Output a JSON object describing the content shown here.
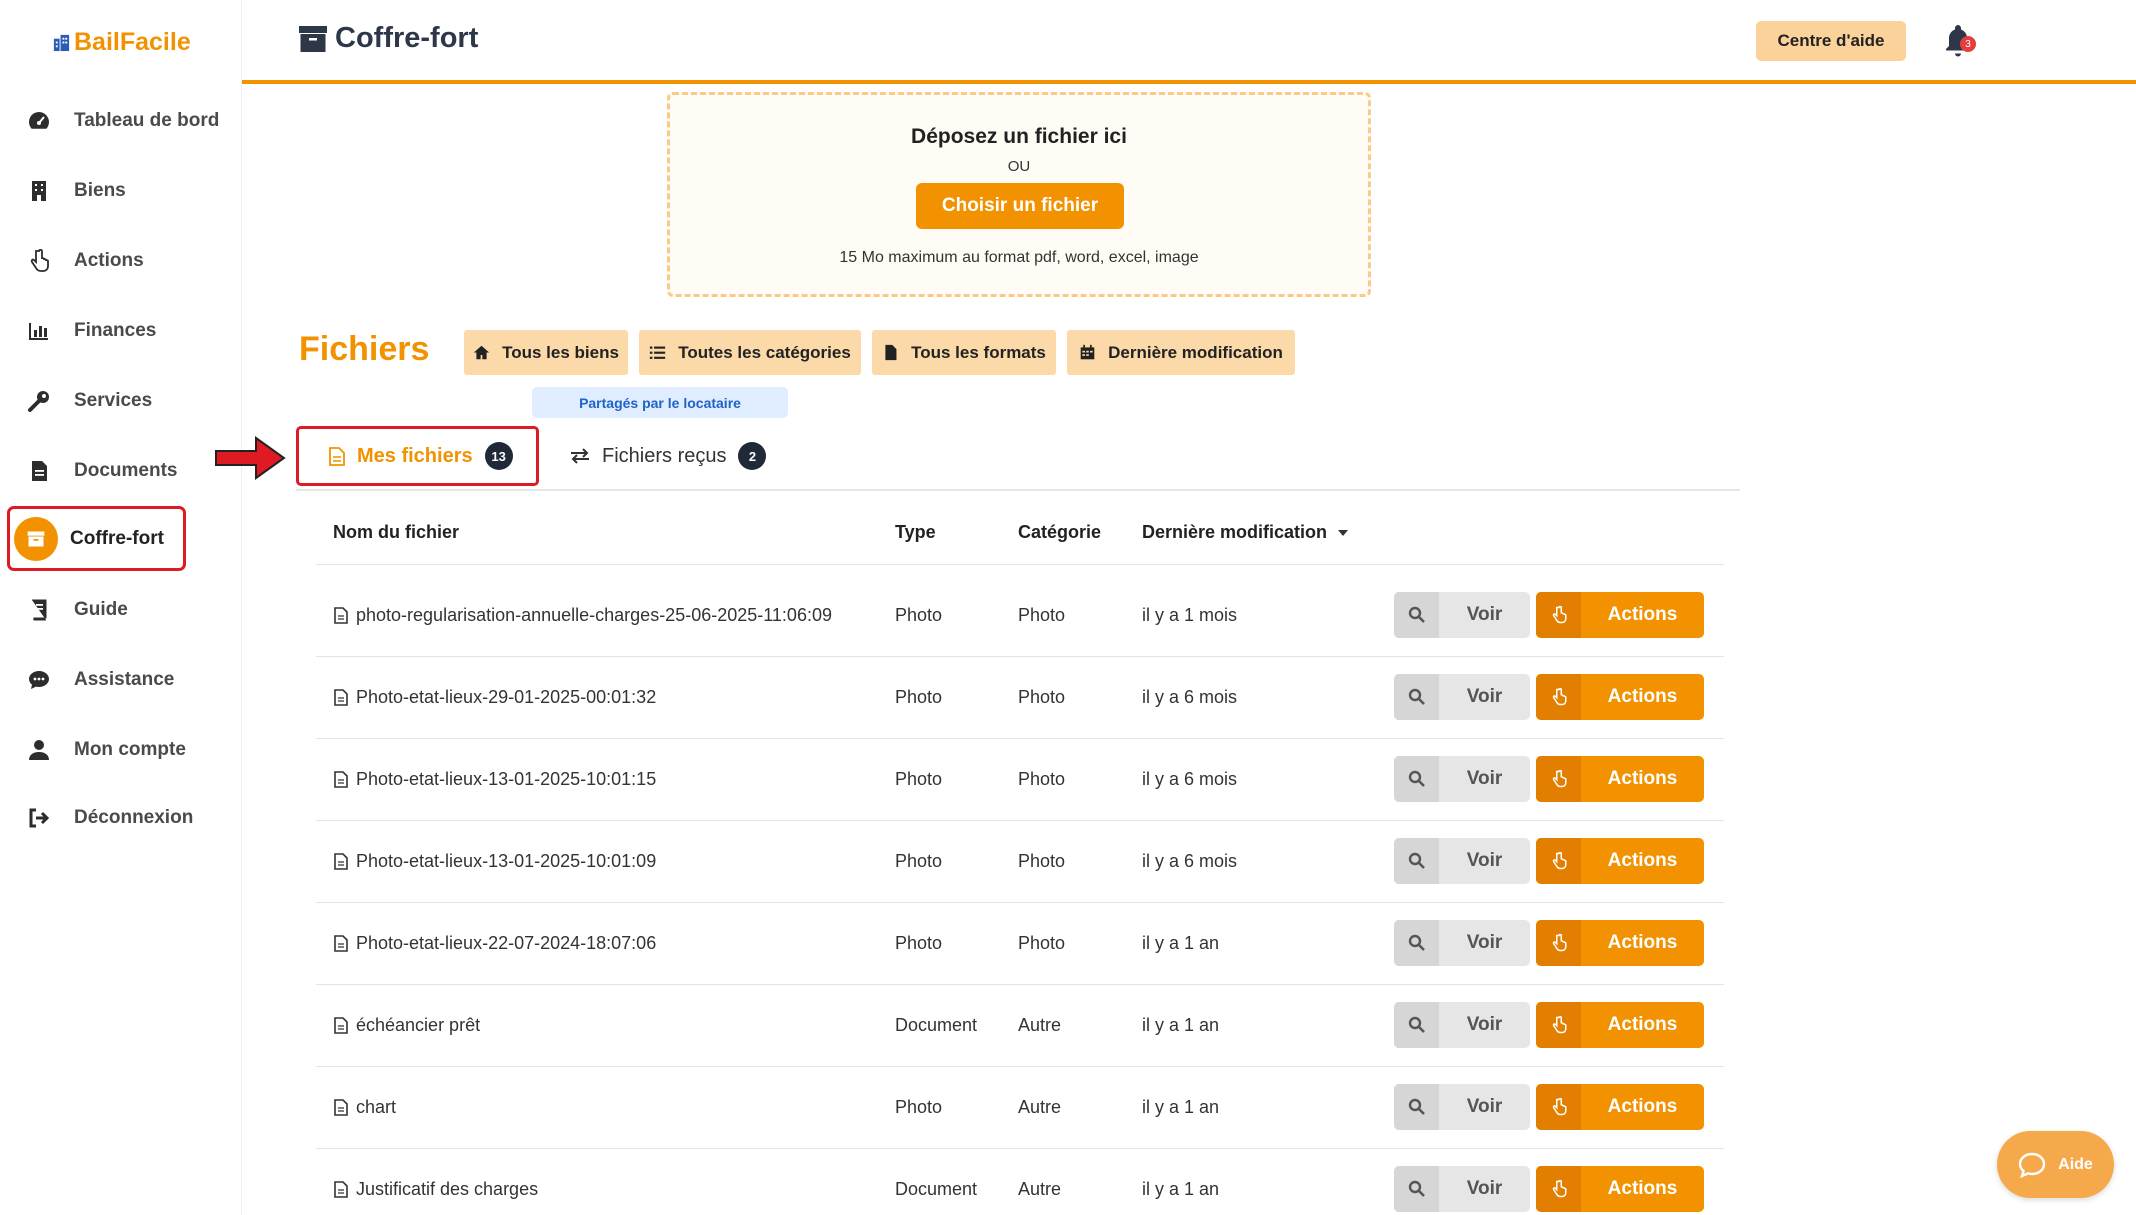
{
  "brand": {
    "name": "BailFacile",
    "color": "#f39200"
  },
  "sidebar": {
    "items": [
      {
        "label": "Tableau de bord",
        "icon": "dashboard-icon"
      },
      {
        "label": "Biens",
        "icon": "building-icon"
      },
      {
        "label": "Actions",
        "icon": "pointer-hand-icon"
      },
      {
        "label": "Finances",
        "icon": "bar-chart-icon"
      },
      {
        "label": "Services",
        "icon": "wrench-icon"
      },
      {
        "label": "Documents",
        "icon": "document-icon"
      },
      {
        "label": "Coffre-fort",
        "icon": "archive-icon",
        "active": true
      },
      {
        "label": "Guide",
        "icon": "book-icon"
      },
      {
        "label": "Assistance",
        "icon": "chat-icon"
      },
      {
        "label": "Mon compte",
        "icon": "user-icon"
      },
      {
        "label": "Déconnexion",
        "icon": "logout-icon"
      }
    ]
  },
  "header": {
    "title": "Coffre-fort",
    "help_label": "Centre d'aide",
    "notification_count": "3"
  },
  "upload": {
    "title": "Déposez un fichier ici",
    "or": "OU",
    "button": "Choisir un fichier",
    "hint": "15 Mo maximum au format pdf, word, excel, image"
  },
  "files": {
    "title": "Fichiers",
    "filters": [
      "Tous les biens",
      "Toutes les catégories",
      "Tous les formats",
      "Dernière modification"
    ],
    "shared_badge": "Partagés par le locataire",
    "tabs": [
      {
        "label": "Mes fichiers",
        "count": "13",
        "active": true
      },
      {
        "label": "Fichiers reçus",
        "count": "2"
      }
    ],
    "columns": [
      "Nom du fichier",
      "Type",
      "Catégorie",
      "Dernière modification"
    ],
    "view_label": "Voir",
    "actions_label": "Actions",
    "rows": [
      {
        "name": "photo-regularisation-annuelle-charges-25-06-2025-11:06:09",
        "type": "Photo",
        "category": "Photo",
        "modified": "il y a 1 mois"
      },
      {
        "name": "Photo-etat-lieux-29-01-2025-00:01:32",
        "type": "Photo",
        "category": "Photo",
        "modified": "il y a 6 mois"
      },
      {
        "name": "Photo-etat-lieux-13-01-2025-10:01:15",
        "type": "Photo",
        "category": "Photo",
        "modified": "il y a 6 mois"
      },
      {
        "name": "Photo-etat-lieux-13-01-2025-10:01:09",
        "type": "Photo",
        "category": "Photo",
        "modified": "il y a 6 mois"
      },
      {
        "name": "Photo-etat-lieux-22-07-2024-18:07:06",
        "type": "Photo",
        "category": "Photo",
        "modified": "il y a 1 an"
      },
      {
        "name": "échéancier prêt",
        "type": "Document",
        "category": "Autre",
        "modified": "il y a 1 an"
      },
      {
        "name": "chart",
        "type": "Photo",
        "category": "Autre",
        "modified": "il y a 1 an"
      },
      {
        "name": "Justificatif des charges",
        "type": "Document",
        "category": "Autre",
        "modified": "il y a 1 an"
      }
    ]
  },
  "aide_button": "Aide"
}
